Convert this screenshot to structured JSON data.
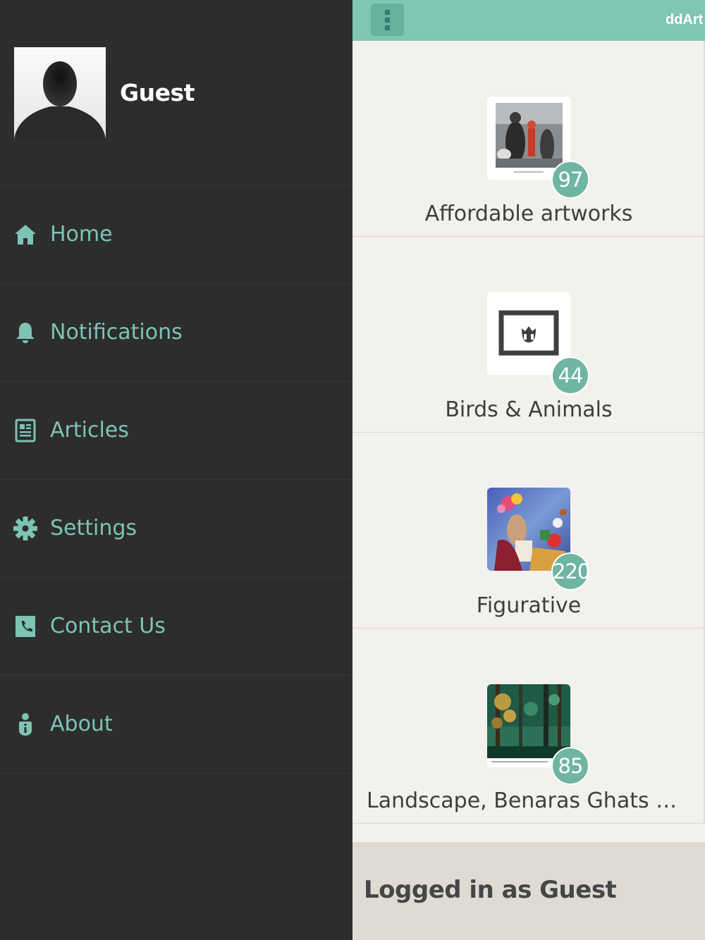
{
  "drawer": {
    "user_name": "Guest",
    "items": [
      {
        "label": "Home",
        "icon": "home-icon"
      },
      {
        "label": "Notifications",
        "icon": "bell-icon"
      },
      {
        "label": "Articles",
        "icon": "article-icon"
      },
      {
        "label": "Settings",
        "icon": "gear-icon"
      },
      {
        "label": "Contact Us",
        "icon": "phone-book-icon"
      },
      {
        "label": "About",
        "icon": "info-person-icon"
      }
    ]
  },
  "toolbar": {
    "title": "ddArt"
  },
  "categories": [
    {
      "name": "Affordable artworks",
      "count": "97"
    },
    {
      "name": "Birds & Animals",
      "count": "44"
    },
    {
      "name": "Figurative",
      "count": "220"
    },
    {
      "name": "Landscape, Benaras Ghats  & Cit…",
      "count": "85"
    }
  ],
  "footer": {
    "status": "Logged in as Guest"
  },
  "colors": {
    "accent": "#7cc4b3",
    "toolbar": "#7fc6b5",
    "drawer_bg": "#2d2d2d",
    "badge": "#6fb5a2"
  }
}
